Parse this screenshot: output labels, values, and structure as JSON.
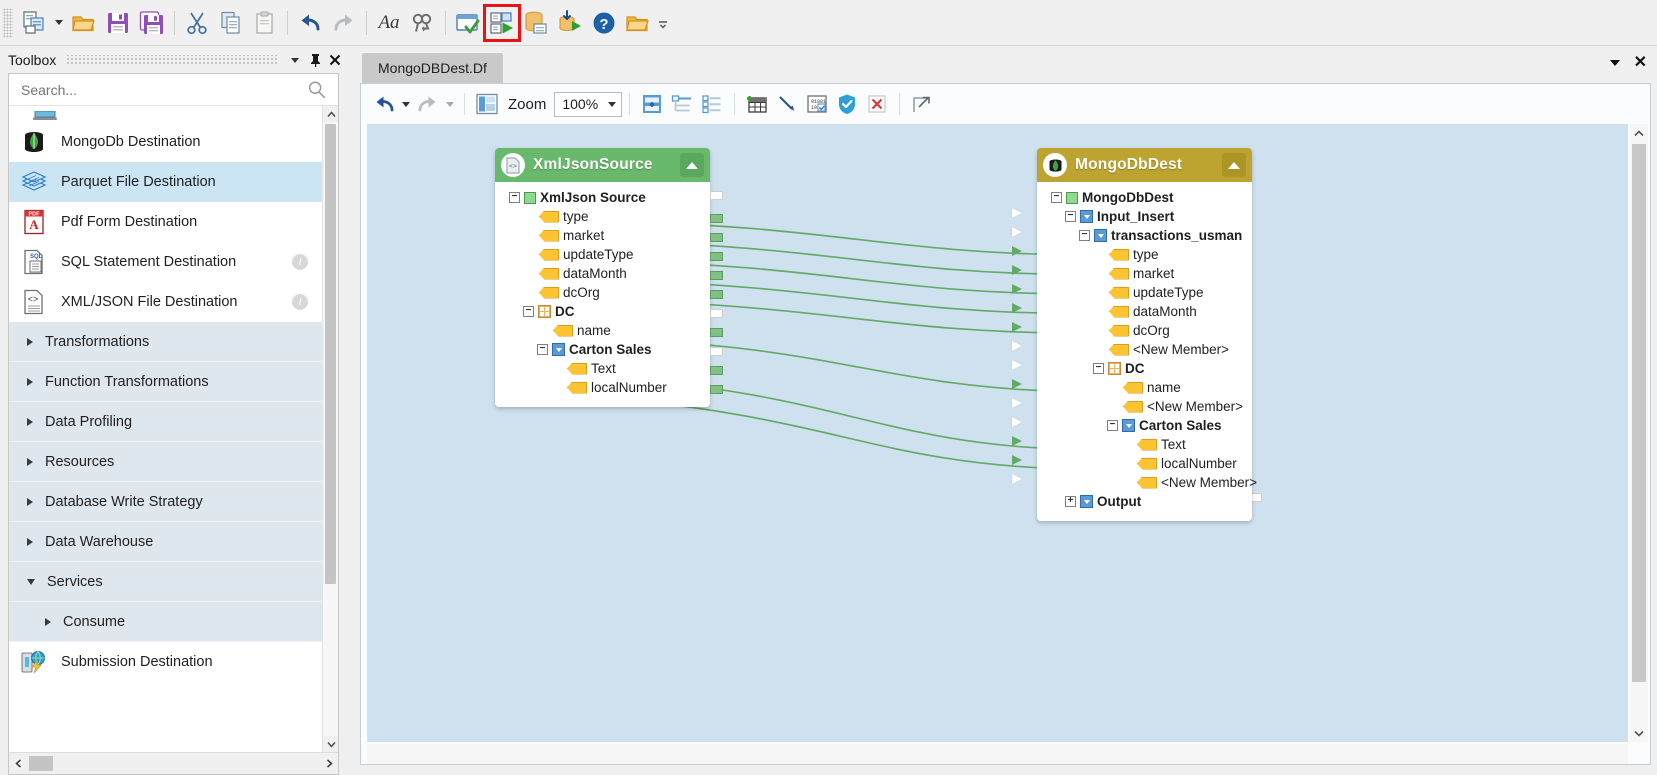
{
  "main_toolbar": {
    "items": [
      {
        "name": "new-item-button",
        "icon": "new-document-icon",
        "tooltip": "New"
      },
      {
        "name": "new-item-dropdown",
        "icon": "caret-down-icon",
        "tooltip": "New dropdown"
      },
      {
        "name": "open-button",
        "icon": "open-folder-icon",
        "tooltip": "Open"
      },
      {
        "name": "save-button",
        "icon": "save-floppy-icon",
        "tooltip": "Save"
      },
      {
        "name": "save-all-button",
        "icon": "save-all-floppy-icon",
        "tooltip": "Save All"
      },
      {
        "name": "cut-button",
        "icon": "scissors-icon",
        "tooltip": "Cut"
      },
      {
        "name": "copy-button",
        "icon": "copy-pages-icon",
        "tooltip": "Copy"
      },
      {
        "name": "paste-button",
        "icon": "clipboard-paste-icon",
        "tooltip": "Paste"
      },
      {
        "name": "undo-button",
        "icon": "undo-arrow-icon",
        "tooltip": "Undo"
      },
      {
        "name": "redo-button",
        "icon": "redo-arrow-icon",
        "tooltip": "Redo"
      },
      {
        "name": "font-button",
        "icon": "font-Aa-icon",
        "tooltip": "Font"
      },
      {
        "name": "find-replace-button",
        "icon": "binoculars-icon",
        "tooltip": "Find and Replace"
      },
      {
        "name": "verify-button",
        "icon": "window-check-icon",
        "tooltip": "Verify"
      },
      {
        "name": "run-dataflow-button",
        "icon": "run-dataflow-green-play-icon",
        "tooltip": "Run Dataflow",
        "highlighted": true
      },
      {
        "name": "data-profile-button",
        "icon": "database-card-icon",
        "tooltip": "Profile"
      },
      {
        "name": "run-job-button",
        "icon": "job-run-green-play-icon",
        "tooltip": "Run Job"
      },
      {
        "name": "help-button",
        "icon": "question-mark-circle-icon",
        "tooltip": "Help"
      },
      {
        "name": "open-project-button",
        "icon": "open-folder-icon",
        "tooltip": "Open Project"
      },
      {
        "name": "toolbar-overflow-button",
        "icon": "overflow-chevron-icon",
        "tooltip": "More"
      }
    ],
    "highlight_color": "#e81414"
  },
  "toolbox": {
    "title": "Toolbox",
    "header_buttons": [
      {
        "name": "toolbox-menu-button",
        "icon": "caret-down-icon"
      },
      {
        "name": "toolbox-pin-button",
        "icon": "pin-icon"
      },
      {
        "name": "toolbox-close-button",
        "icon": "close-icon"
      }
    ],
    "search": {
      "placeholder": "Search...",
      "value": "",
      "icon": "search-icon"
    },
    "items": [
      {
        "kind": "item",
        "name": "toolbox-item-partial-top",
        "label": "",
        "icon": "partial-clipped-icon",
        "selected": false,
        "info": false,
        "partial": true
      },
      {
        "kind": "item",
        "name": "toolbox-item-mongodb-destination",
        "label": "MongoDb Destination",
        "icon": "mongodb-leaf-icon",
        "selected": false,
        "info": false
      },
      {
        "kind": "item",
        "name": "toolbox-item-parquet-file-destination",
        "label": "Parquet File Destination",
        "icon": "parquet-layers-icon",
        "selected": true,
        "info": false
      },
      {
        "kind": "item",
        "name": "toolbox-item-pdf-form-destination",
        "label": "Pdf Form Destination",
        "icon": "pdf-file-icon",
        "selected": false,
        "info": false
      },
      {
        "kind": "item",
        "name": "toolbox-item-sql-statement-destination",
        "label": "SQL Statement Destination",
        "icon": "sql-file-icon",
        "selected": false,
        "info": true
      },
      {
        "kind": "item",
        "name": "toolbox-item-xml-json-file-destination",
        "label": "XML/JSON File Destination",
        "icon": "xml-file-icon",
        "selected": false,
        "info": true
      },
      {
        "kind": "category",
        "name": "toolbox-category-transformations",
        "label": "Transformations",
        "expanded": false,
        "indent": false
      },
      {
        "kind": "category",
        "name": "toolbox-category-function-transformations",
        "label": "Function Transformations",
        "expanded": false,
        "indent": false
      },
      {
        "kind": "category",
        "name": "toolbox-category-data-profiling",
        "label": "Data Profiling",
        "expanded": false,
        "indent": false
      },
      {
        "kind": "category",
        "name": "toolbox-category-resources",
        "label": "Resources",
        "expanded": false,
        "indent": false
      },
      {
        "kind": "category",
        "name": "toolbox-category-database-write-strategy",
        "label": "Database Write Strategy",
        "expanded": false,
        "indent": false
      },
      {
        "kind": "category",
        "name": "toolbox-category-data-warehouse",
        "label": "Data Warehouse",
        "expanded": false,
        "indent": false
      },
      {
        "kind": "category",
        "name": "toolbox-category-services",
        "label": "Services",
        "expanded": true,
        "indent": false
      },
      {
        "kind": "category",
        "name": "toolbox-category-consume",
        "label": "Consume",
        "expanded": false,
        "indent": true
      },
      {
        "kind": "item",
        "name": "toolbox-item-submission-destination",
        "label": "Submission Destination",
        "icon": "submission-globe-icon",
        "selected": false,
        "info": false
      }
    ],
    "selected_color": "#cbe5f5"
  },
  "document": {
    "tab": {
      "label": "MongoDBDest.Df",
      "name": "tab-mongodbdest-df"
    },
    "tabstrip_buttons": [
      {
        "name": "tab-list-dropdown-button",
        "icon": "caret-down-icon"
      },
      {
        "name": "tab-close-button",
        "icon": "close-icon"
      }
    ],
    "dataflow_toolbar": {
      "zoom_label": "Zoom",
      "zoom_value": "100%",
      "buttons": [
        {
          "name": "dataflow-undo-button",
          "icon": "undo-arrow-icon"
        },
        {
          "name": "dataflow-undo-dropdown",
          "icon": "caret-down-icon"
        },
        {
          "name": "dataflow-redo-button",
          "icon": "redo-arrow-icon"
        },
        {
          "name": "dataflow-redo-dropdown",
          "icon": "caret-down-icon"
        },
        {
          "name": "zoom-preview-button",
          "icon": "zoom-layout-icon"
        },
        {
          "name": "zoom-combo",
          "icon": "combo-caret-icon"
        },
        {
          "name": "auto-layout-button",
          "icon": "auto-layout-vertical-icon"
        },
        {
          "name": "tree-layout-button",
          "icon": "tree-outline-icon"
        },
        {
          "name": "list-layout-button",
          "icon": "list-outline-icon"
        },
        {
          "name": "add-table-button",
          "icon": "add-grid-table-icon"
        },
        {
          "name": "draw-link-button",
          "icon": "diagonal-link-line-icon"
        },
        {
          "name": "data-preview-button",
          "icon": "binary-check-icon"
        },
        {
          "name": "validate-button",
          "icon": "blue-shield-check-icon"
        },
        {
          "name": "delete-button",
          "icon": "red-x-box-icon"
        },
        {
          "name": "expand-view-button",
          "icon": "expand-arrow-box-icon"
        }
      ]
    }
  },
  "canvas": {
    "background_color": "#cfe0ef",
    "link_color": "#62ab66",
    "nodes": [
      {
        "name": "node-xmljsonsource",
        "type": "source",
        "title": "XmlJsonSource",
        "header_color": "#68b96c",
        "header_icon": "xml-document-icon",
        "collapse_icon": "collapse-up-triangle-icon",
        "tree": [
          {
            "label": "XmlJson Source",
            "depth": 0,
            "glyph": "green-square",
            "expander": "minus",
            "bold": true
          },
          {
            "label": "type",
            "depth": 1,
            "glyph": "yellow-tag",
            "expander": "none",
            "bold": false
          },
          {
            "label": "market",
            "depth": 1,
            "glyph": "yellow-tag",
            "expander": "none",
            "bold": false
          },
          {
            "label": "updateType",
            "depth": 1,
            "glyph": "yellow-tag",
            "expander": "none",
            "bold": false
          },
          {
            "label": "dataMonth",
            "depth": 1,
            "glyph": "yellow-tag",
            "expander": "none",
            "bold": false
          },
          {
            "label": "dcOrg",
            "depth": 1,
            "glyph": "yellow-tag",
            "expander": "none",
            "bold": false
          },
          {
            "label": "DC",
            "depth": 1,
            "glyph": "orange-grid",
            "expander": "minus",
            "bold": true
          },
          {
            "label": "name",
            "depth": 2,
            "glyph": "yellow-tag",
            "expander": "none",
            "bold": false
          },
          {
            "label": "Carton Sales",
            "depth": 2,
            "glyph": "blue-square",
            "expander": "minus",
            "bold": true
          },
          {
            "label": "Text",
            "depth": 3,
            "glyph": "yellow-tag",
            "expander": "none",
            "bold": false
          },
          {
            "label": "localNumber",
            "depth": 3,
            "glyph": "yellow-tag",
            "expander": "none",
            "bold": false
          }
        ],
        "ports": [
          "empty",
          "filled",
          "filled",
          "filled",
          "filled",
          "filled",
          "empty",
          "filled",
          "empty",
          "filled",
          "filled"
        ]
      },
      {
        "name": "node-mongodbdest",
        "type": "destination",
        "title": "MongoDbDest",
        "header_color": "#bda32f",
        "header_icon": "mongodb-leaf-icon",
        "collapse_icon": "collapse-up-triangle-icon",
        "tree": [
          {
            "label": "MongoDbDest",
            "depth": 0,
            "glyph": "green-square",
            "expander": "minus",
            "bold": true
          },
          {
            "label": "Input_Insert",
            "depth": 1,
            "glyph": "blue-square",
            "expander": "minus",
            "bold": true
          },
          {
            "label": "transactions_usman",
            "depth": 2,
            "glyph": "blue-square",
            "expander": "minus",
            "bold": true
          },
          {
            "label": "type",
            "depth": 3,
            "glyph": "yellow-tag",
            "expander": "none",
            "bold": false
          },
          {
            "label": "market",
            "depth": 3,
            "glyph": "yellow-tag",
            "expander": "none",
            "bold": false
          },
          {
            "label": "updateType",
            "depth": 3,
            "glyph": "yellow-tag",
            "expander": "none",
            "bold": false
          },
          {
            "label": "dataMonth",
            "depth": 3,
            "glyph": "yellow-tag",
            "expander": "none",
            "bold": false
          },
          {
            "label": "dcOrg",
            "depth": 3,
            "glyph": "yellow-tag",
            "expander": "none",
            "bold": false
          },
          {
            "label": "<New Member>",
            "depth": 3,
            "glyph": "yellow-tag",
            "expander": "none",
            "bold": false
          },
          {
            "label": "DC",
            "depth": 3,
            "glyph": "orange-grid",
            "expander": "minus",
            "bold": true
          },
          {
            "label": "name",
            "depth": 4,
            "glyph": "yellow-tag",
            "expander": "none",
            "bold": false
          },
          {
            "label": "<New Member>",
            "depth": 4,
            "glyph": "yellow-tag",
            "expander": "none",
            "bold": false
          },
          {
            "label": "Carton Sales",
            "depth": 4,
            "glyph": "blue-square",
            "expander": "minus",
            "bold": true
          },
          {
            "label": "Text",
            "depth": 5,
            "glyph": "yellow-tag",
            "expander": "none",
            "bold": false
          },
          {
            "label": "localNumber",
            "depth": 5,
            "glyph": "yellow-tag",
            "expander": "none",
            "bold": false
          },
          {
            "label": "<New Member>",
            "depth": 5,
            "glyph": "yellow-tag",
            "expander": "none",
            "bold": false
          },
          {
            "label": "Output",
            "depth": 1,
            "glyph": "blue-square",
            "expander": "plus",
            "bold": true
          }
        ],
        "ports": [
          "none",
          "empty",
          "empty",
          "filled",
          "filled",
          "filled",
          "filled",
          "filled",
          "empty",
          "empty",
          "filled",
          "empty",
          "empty",
          "filled",
          "filled",
          "empty",
          "right-stub"
        ]
      }
    ],
    "links_count": 8
  },
  "scrollbars": {
    "toolbox_vertical": {
      "name": "toolbox-vertical-scrollbar"
    },
    "toolbox_horizontal": {
      "name": "toolbox-horizontal-scrollbar"
    },
    "canvas_vertical": {
      "name": "canvas-vertical-scrollbar"
    },
    "canvas_horizontal": {
      "name": "canvas-horizontal-scrollbar"
    }
  }
}
